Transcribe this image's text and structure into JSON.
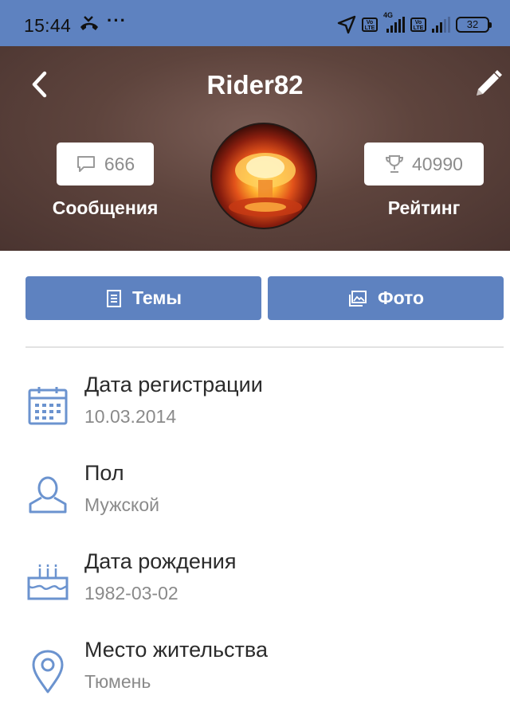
{
  "status_bar": {
    "time": "15:44",
    "dots": "···",
    "network_tag": "4G",
    "volte": "Vo LTE",
    "battery": "32",
    "icons": [
      "missed-call-icon",
      "location-arrow-icon",
      "signal-icon",
      "battery-icon"
    ]
  },
  "profile": {
    "username": "Rider82",
    "messages_count": "666",
    "messages_label": "Сообщения",
    "rating_count": "40990",
    "rating_label": "Рейтинг"
  },
  "actions": {
    "topics_label": "Темы",
    "photo_label": "Фото"
  },
  "info": [
    {
      "title": "Дата регистрации",
      "value": "10.03.2014",
      "icon": "calendar-icon"
    },
    {
      "title": "Пол",
      "value": "Мужской",
      "icon": "person-icon"
    },
    {
      "title": "Дата рождения",
      "value": "1982-03-02",
      "icon": "birthday-cake-icon"
    },
    {
      "title": "Место жительства",
      "value": "Тюмень",
      "icon": "location-pin-icon"
    }
  ],
  "colors": {
    "accent": "#5e82c0",
    "header_bg": "#5e443d",
    "icon_blue": "#6b93cf",
    "muted_text": "#8a8a8a"
  }
}
